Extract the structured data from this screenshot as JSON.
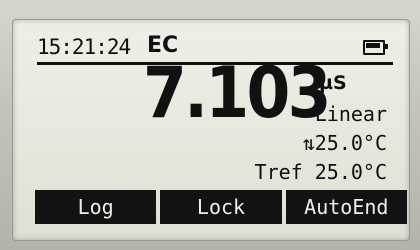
{
  "status": {
    "time": "15:21:24",
    "mode": "EC",
    "battery_icon": "battery-full-icon"
  },
  "measurement": {
    "value": "7.103",
    "unit": "µS",
    "curve": "Linear",
    "temperature": "⇅25.0°C",
    "tref": "Tref 25.0°C"
  },
  "softkeys": [
    {
      "label": "Log"
    },
    {
      "label": "Lock"
    },
    {
      "label": "AutoEnd"
    }
  ]
}
